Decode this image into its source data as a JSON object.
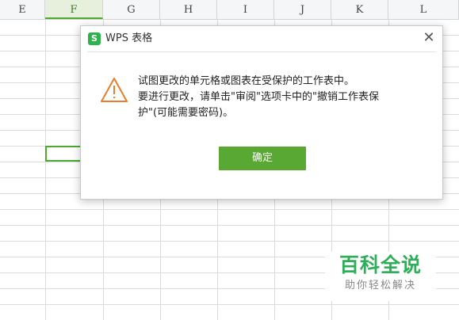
{
  "sheet": {
    "columns": [
      "E",
      "F",
      "G",
      "H",
      "I",
      "J",
      "K",
      "L"
    ],
    "selected_column": "F"
  },
  "dialog": {
    "title": "WPS 表格",
    "logo_glyph": "S",
    "close_glyph": "✕",
    "message_lines": [
      "试图更改的单元格或图表在受保护的工作表中。",
      "要进行更改，请单击\"审阅\"选项卡中的\"撤销工作表保",
      "护\"(可能需要密码)。"
    ],
    "ok_label": "确定",
    "icon": "warning-triangle-icon"
  },
  "watermark": {
    "title": "百科全说",
    "subtitle": "助你轻松解决"
  },
  "colors": {
    "accent_green": "#59a833",
    "logo_green": "#2eb24e",
    "selection_green": "#4caa2e",
    "warning_orange": "#e87d2a",
    "watermark_green": "#2fae5a"
  }
}
